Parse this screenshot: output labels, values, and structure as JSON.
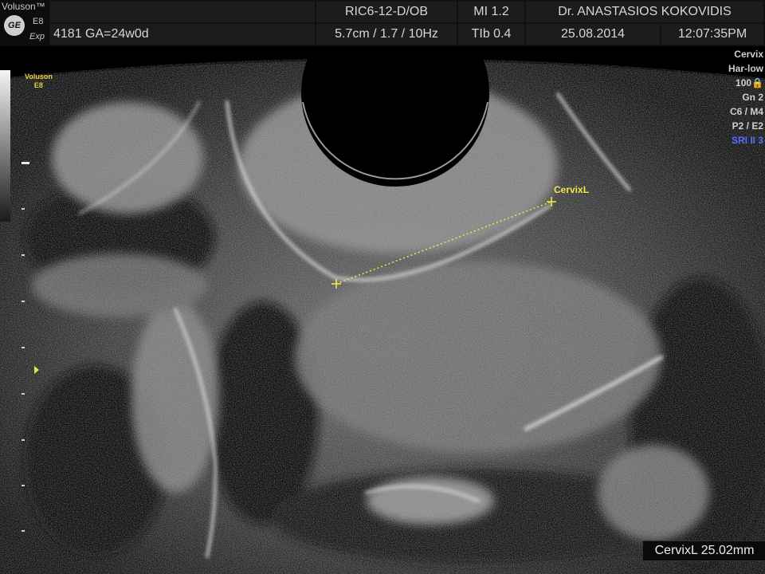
{
  "brand": {
    "name": "Voluson™",
    "logo_text": "GE",
    "model": "E8",
    "variant": "Exp"
  },
  "header": {
    "probe_preset": "RIC6-12-D/OB",
    "mi": "MI  1.2",
    "operator": "Dr. ANASTASIOS KOKOVIDIS",
    "patient": "4181  GA=24w0d",
    "depth_settings": "5.7cm / 1.7 / 10Hz",
    "tib": "TIb  0.4",
    "date": "25.08.2014",
    "time": "12:07:35PM"
  },
  "probe_logo": {
    "line1": "Voluson",
    "line2": "E8"
  },
  "parameters": [
    "Cervix",
    "Har-low",
    "100",
    "Gn   2",
    "C6 / M4",
    "P2 / E2",
    "SRI II 3"
  ],
  "colors": {
    "measurement": "#f2e64a",
    "sri": "#5a6cff",
    "header_bg": "#1c1c1c"
  },
  "measurement": {
    "label": "CervixL",
    "result": "CervixL 25.02mm"
  }
}
